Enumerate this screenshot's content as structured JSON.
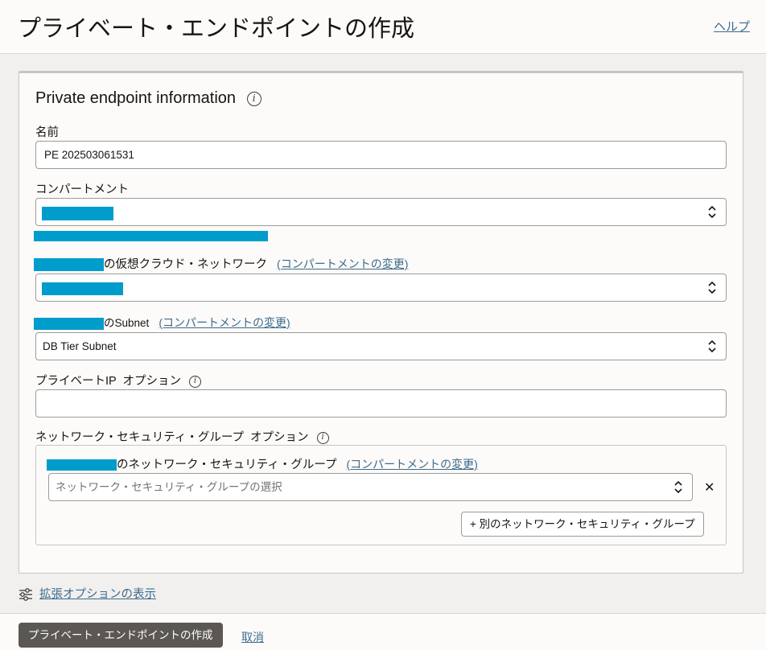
{
  "header": {
    "title": "プライベート・エンドポイントの作成",
    "help_label": "ヘルプ"
  },
  "section": {
    "title": "Private endpoint information",
    "info_icon": "info-icon"
  },
  "name_field": {
    "label": "名前",
    "value": "PE 202503061531"
  },
  "compartment": {
    "label": "コンパートメント"
  },
  "vcn": {
    "label_suffix": "の仮想クラウド・ネットワーク",
    "change_link": "(コンパートメントの変更)"
  },
  "subnet": {
    "label_suffix": "のSubnet",
    "change_link": "(コンパートメントの変更)",
    "value": "DB Tier Subnet"
  },
  "private_ip": {
    "label": "プライベートIP  オプション"
  },
  "nsg": {
    "label": "ネットワーク・セキュリティ・グループ  オプション",
    "group_label_suffix": "のネットワーク・セキュリティ・グループ",
    "change_link": "(コンパートメントの変更)",
    "placeholder": "ネットワーク・セキュリティ・グループの選択",
    "add_button": "+ 別のネットワーク・セキュリティ・グループ"
  },
  "advanced": {
    "link": "拡張オプションの表示",
    "icon": "sliders-icon"
  },
  "footer": {
    "create_button": "プライベート・エンドポイントの作成",
    "cancel_link": "取消"
  },
  "colors": {
    "redaction": "#009ccc",
    "link": "#3d6b8c",
    "primary_button": "#5b5753"
  }
}
